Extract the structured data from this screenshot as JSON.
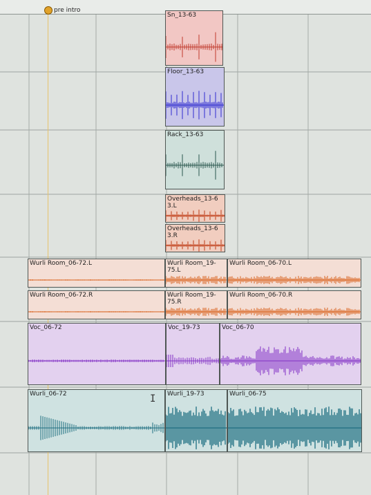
{
  "marker": {
    "label": "pre intro",
    "icon": "marker-icon"
  },
  "clips": [
    {
      "id": "sn",
      "name": "Sn_13-63",
      "color": "#f2c7c4",
      "wave": "#c0392b"
    },
    {
      "id": "floor",
      "name": "Floor_13-63",
      "color": "#c9c6ea",
      "wave": "#2e2bd0"
    },
    {
      "id": "rack",
      "name": "Rack_13-63",
      "color": "#cfe0db",
      "wave": "#29564d"
    },
    {
      "id": "oh-l",
      "name": "Overheads_13-6\n3.L",
      "color": "#f1cdbf",
      "wave": "#bf3b16"
    },
    {
      "id": "oh-r",
      "name": "Overheads_13-6\n3.R",
      "color": "#f1cdbf",
      "wave": "#bf3b16"
    },
    {
      "id": "wr0672l",
      "name": "Wurli Room_06-72.L",
      "color": "#f4ded5",
      "wave": "#d9631f"
    },
    {
      "id": "wr1975l",
      "name": "Wurli Room_19-\n75.L",
      "color": "#f4ded5",
      "wave": "#d9631f"
    },
    {
      "id": "wr0670l",
      "name": "Wurli Room_06-70.L",
      "color": "#f4ded5",
      "wave": "#d9631f"
    },
    {
      "id": "wr0672r",
      "name": "Wurli Room_06-72.R",
      "color": "#f4ded5",
      "wave": "#d9631f"
    },
    {
      "id": "wr1975r",
      "name": "Wurli Room_19-\n75.R",
      "color": "#f4ded5",
      "wave": "#d9631f"
    },
    {
      "id": "wr0670r",
      "name": "Wurli Room_06-70.R",
      "color": "#f4ded5",
      "wave": "#d9631f"
    },
    {
      "id": "voc0672",
      "name": "Voc_06-72",
      "color": "#e3d1ef",
      "wave": "#8130c4"
    },
    {
      "id": "voc1973",
      "name": "Voc_19-73",
      "color": "#e3d1ef",
      "wave": "#8130c4"
    },
    {
      "id": "voc0670",
      "name": "Voc_06-70",
      "color": "#e3d1ef",
      "wave": "#8130c4"
    },
    {
      "id": "wurli0672",
      "name": "Wurli_06-72",
      "color": "#cfe2e1",
      "wave": "#1c6d80"
    },
    {
      "id": "wurli1973",
      "name": "Wurli_19-73",
      "color": "#cfe2e1",
      "wave": "#1c6d80"
    },
    {
      "id": "wurli0675",
      "name": "Wurli_06-75",
      "color": "#cfe2e1",
      "wave": "#1c6d80"
    }
  ],
  "cursor": "I"
}
